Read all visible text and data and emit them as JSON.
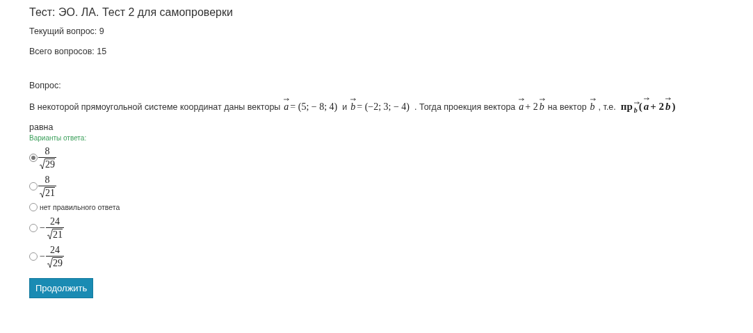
{
  "title": "Тест: ЭО. ЛА. Тест 2 для самопроверки",
  "current_question": "Текущий вопрос: 9",
  "total_questions": "Всего вопросов: 15",
  "question_label": "Вопрос:",
  "question": [
    {
      "kind": "text",
      "text": "В некоторой прямоугольной системе координат даны векторы"
    },
    {
      "kind": "math",
      "tokens": [
        {
          "kind": "vec",
          "text": "a"
        },
        {
          "kind": "sym",
          "text": "= (5; − 8; 4)"
        }
      ]
    },
    {
      "kind": "text",
      "text": "и"
    },
    {
      "kind": "math",
      "tokens": [
        {
          "kind": "vec",
          "text": "b"
        },
        {
          "kind": "sym",
          "text": "= (−2; 3; − 4)"
        }
      ]
    },
    {
      "kind": "text",
      "text": ". Тогда проекция вектора"
    },
    {
      "kind": "math",
      "tokens": [
        {
          "kind": "vec",
          "text": "a"
        },
        {
          "kind": "sym",
          "text": "+ 2"
        },
        {
          "kind": "vec",
          "text": "b"
        }
      ]
    },
    {
      "kind": "text",
      "text": "на вектор"
    },
    {
      "kind": "math",
      "tokens": [
        {
          "kind": "vec",
          "text": "b"
        }
      ]
    },
    {
      "kind": "text",
      "text": ", т.е."
    },
    {
      "kind": "math",
      "bold": true,
      "tokens": [
        {
          "kind": "sym",
          "text": "пр"
        },
        {
          "kind": "subvec",
          "text": "b"
        },
        {
          "kind": "sym",
          "text": "("
        },
        {
          "kind": "vec",
          "text": "a"
        },
        {
          "kind": "sym",
          "text": "+ 2"
        },
        {
          "kind": "vec",
          "text": "b"
        },
        {
          "kind": "sym",
          "text": ")"
        }
      ]
    },
    {
      "kind": "text",
      "text": "равна"
    }
  ],
  "answers_label": "Варианты ответа:",
  "answers": [
    {
      "kind": "fraction",
      "selected": true,
      "numerator": "8",
      "radicand": "29"
    },
    {
      "kind": "fraction",
      "selected": false,
      "numerator": "8",
      "radicand": "21"
    },
    {
      "kind": "text",
      "selected": false,
      "text": "нет правильного ответа"
    },
    {
      "kind": "fraction",
      "selected": false,
      "sign": "−",
      "numerator": "24",
      "radicand": "21"
    },
    {
      "kind": "fraction",
      "selected": false,
      "sign": "−",
      "numerator": "24",
      "radicand": "29"
    }
  ],
  "continue_button": "Продолжить"
}
